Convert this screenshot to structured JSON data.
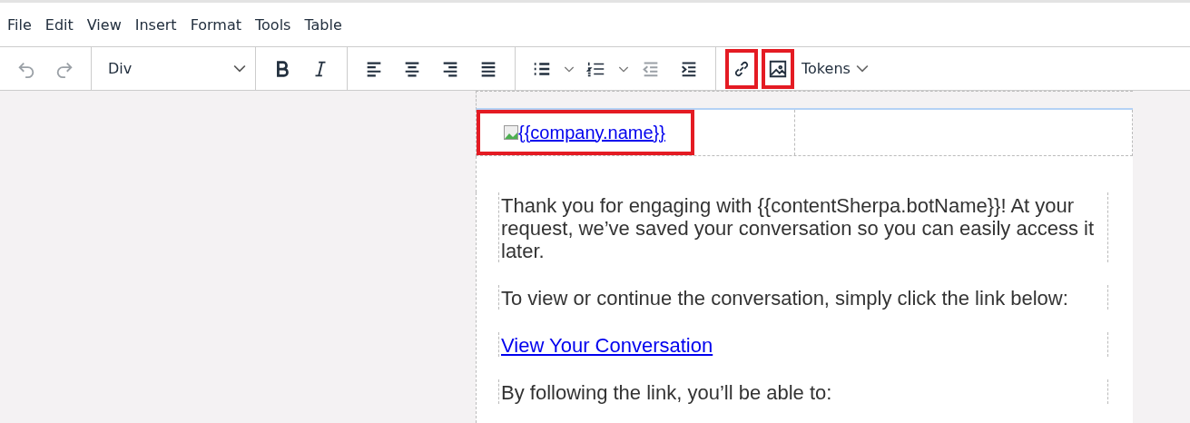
{
  "menu": [
    {
      "label": "File"
    },
    {
      "label": "Edit"
    },
    {
      "label": "View"
    },
    {
      "label": "Insert"
    },
    {
      "label": "Format"
    },
    {
      "label": "Tools"
    },
    {
      "label": "Table"
    }
  ],
  "toolbar": [
    [
      {
        "kind": "undo",
        "disabled": true,
        "highlighted": false
      },
      {
        "kind": "redo",
        "disabled": true,
        "highlighted": false
      }
    ],
    [
      {
        "kind": "select",
        "value": "Div"
      }
    ],
    [
      {
        "kind": "bold",
        "disabled": false,
        "highlighted": false
      },
      {
        "kind": "italic",
        "disabled": false,
        "highlighted": false
      }
    ],
    [
      {
        "kind": "align-left",
        "disabled": false,
        "highlighted": false
      },
      {
        "kind": "align-center",
        "disabled": false,
        "highlighted": false
      },
      {
        "kind": "align-right",
        "disabled": false,
        "highlighted": false
      },
      {
        "kind": "justify",
        "disabled": false,
        "highlighted": false
      }
    ],
    [
      {
        "kind": "bullet-list",
        "disabled": false,
        "highlighted": false
      },
      {
        "kind": "caret",
        "disabled": false,
        "highlighted": false
      },
      {
        "kind": "numbered-list",
        "disabled": false,
        "highlighted": false
      },
      {
        "kind": "caret",
        "disabled": false,
        "highlighted": false
      },
      {
        "kind": "outdent",
        "disabled": true,
        "highlighted": false
      },
      {
        "kind": "indent",
        "disabled": false,
        "highlighted": false
      }
    ],
    [
      {
        "kind": "link",
        "disabled": false,
        "highlighted": true
      },
      {
        "kind": "image",
        "disabled": false,
        "highlighted": true
      },
      {
        "kind": "menu",
        "label": "Tokens"
      }
    ]
  ],
  "email": {
    "logo": {
      "text": "{{company.name}}",
      "highlighted": true
    },
    "paragraphs": [
      {
        "kind": "text",
        "text": "Thank you for engaging with {{contentSherpa.botName}}! At your request, we’ve saved your conversation so you can easily access it later."
      },
      {
        "kind": "text",
        "text": "To view or continue the conversation, simply click the link below:"
      },
      {
        "kind": "link",
        "text": "View Your Conversation"
      },
      {
        "kind": "text",
        "text": "By following the link, you’ll be able to:"
      }
    ]
  }
}
